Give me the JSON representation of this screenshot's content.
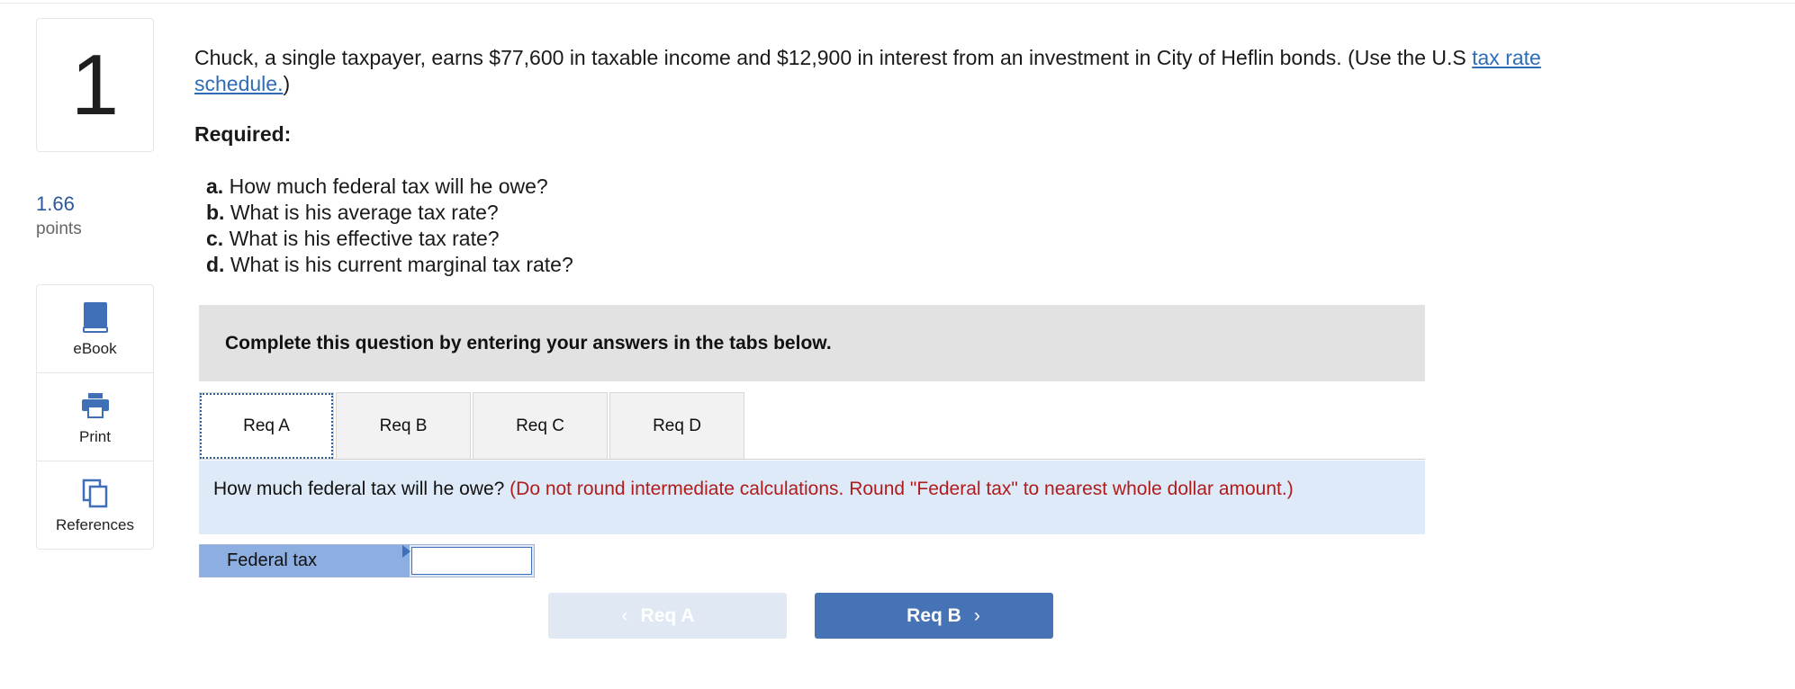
{
  "question": {
    "number": "1",
    "points_value": "1.66",
    "points_label": "points"
  },
  "tools": [
    {
      "label": "eBook",
      "icon": "book-icon"
    },
    {
      "label": "Print",
      "icon": "printer-icon"
    },
    {
      "label": "References",
      "icon": "copy-icon"
    }
  ],
  "prompt": {
    "text_before_link": "Chuck, a single taxpayer, earns $77,600 in taxable income and $12,900 in interest from an investment in City of Heflin bonds. (Use the U.S ",
    "link_text": "tax rate schedule.",
    "text_after_link": ")"
  },
  "required_label": "Required:",
  "requirements": [
    {
      "letter": "a.",
      "text": "How much federal tax will he owe?"
    },
    {
      "letter": "b.",
      "text": "What is his average tax rate?"
    },
    {
      "letter": "c.",
      "text": "What is his effective tax rate?"
    },
    {
      "letter": "d.",
      "text": "What is his current marginal tax rate?"
    }
  ],
  "banner_text": "Complete this question by entering your answers in the tabs below.",
  "tabs": [
    {
      "label": "Req A",
      "active": true
    },
    {
      "label": "Req B",
      "active": false
    },
    {
      "label": "Req C",
      "active": false
    },
    {
      "label": "Req D",
      "active": false
    }
  ],
  "req_panel": {
    "question": "How much federal tax will he owe? ",
    "note": "(Do not round intermediate calculations. Round \"Federal tax\" to nearest whole dollar amount.)"
  },
  "answer": {
    "label": "Federal tax",
    "value": ""
  },
  "nav": {
    "prev_label": "Req A",
    "next_label": "Req B"
  },
  "colors": {
    "link": "#2e6db5",
    "note_red": "#b01c1c",
    "panel_blue": "#deeaf7",
    "button_blue": "#4673b6",
    "label_blue": "#8daee0"
  }
}
